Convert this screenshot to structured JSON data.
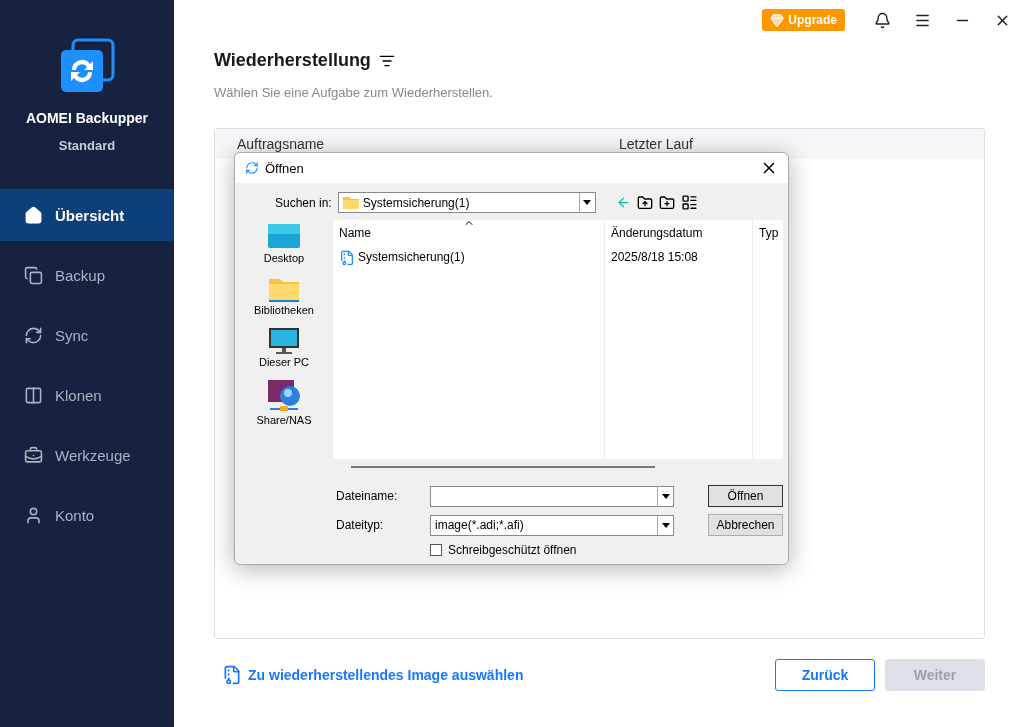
{
  "sidebar": {
    "product": "AOMEI Backupper",
    "edition": "Standard",
    "items": [
      {
        "label": "Übersicht",
        "selected": true
      },
      {
        "label": "Backup",
        "selected": false
      },
      {
        "label": "Sync",
        "selected": false
      },
      {
        "label": "Klonen",
        "selected": false
      },
      {
        "label": "Werkzeuge",
        "selected": false
      },
      {
        "label": "Konto",
        "selected": false
      }
    ]
  },
  "topbar": {
    "upgrade": "Upgrade"
  },
  "page": {
    "title": "Wiederherstellung",
    "subtitle": "Wählen Sie eine Aufgabe zum Wiederherstellen.",
    "columns": [
      "Auftragsname",
      "Letzter Lauf"
    ],
    "link": "Zu wiederherstellendes Image auswählen",
    "buttons": [
      {
        "label": "Zurück",
        "disabled": false
      },
      {
        "label": "Weiter",
        "disabled": true
      }
    ]
  },
  "dialog": {
    "title": "Öffnen",
    "look_in_label": "Suchen in:",
    "look_in_value": "Systemsicherung(1)",
    "places": [
      {
        "label": "Desktop"
      },
      {
        "label": "Bibliotheken"
      },
      {
        "label": "Dieser PC"
      },
      {
        "label": "Share/NAS"
      }
    ],
    "columns": [
      "Name",
      "Änderungsdatum",
      "Typ"
    ],
    "files": [
      {
        "name": "Systemsicherung(1)",
        "modified": "2025/8/18 15:08"
      }
    ],
    "filename_label": "Dateiname:",
    "filetype_label": "Dateityp:",
    "filetype_value": "image(*.adi;*.afi)",
    "readonly": {
      "label": "Schreibgeschützt öffnen",
      "checked": false
    },
    "open_button": "Öffnen",
    "cancel_button": "Abbrechen"
  }
}
